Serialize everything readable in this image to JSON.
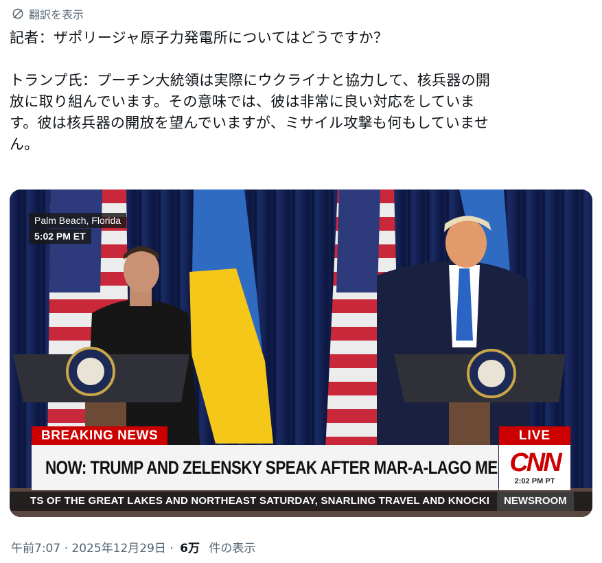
{
  "translate": {
    "label": "翻訳を表示",
    "icon": "translate-icon"
  },
  "tweet": {
    "line1": "記者：ザポリージャ原子力発電所についてはどうですか？",
    "line2": "トランプ氏：プーチン大統領は実際にウクライナと協力して、核兵器の開",
    "line3": "放に取り組んでいます。その意味では、彼は非常に良い対応をしていま",
    "line4": "す。彼は核兵器の開放を望んでいますが、ミサイル攻撃も何もしていませ",
    "line5": "ん。"
  },
  "video": {
    "location": "Palm Beach, Florida",
    "local_time": "5:02 PM ET",
    "breaking": "BREAKING NEWS",
    "live": "LIVE",
    "headline": "NOW: TRUMP AND ZELENSKY SPEAK AFTER MAR-A-LAGO MEETING",
    "network": "CNN",
    "network_time": "2:02 PM PT",
    "ticker": "TS OF THE GREAT LAKES AND NORTHEAST SATURDAY, SNARLING TRAVEL AND KNOCKI",
    "program": "NEWSROOM"
  },
  "meta": {
    "time": "午前7:07",
    "sep1": "·",
    "date": "2025年12月29日",
    "sep2": "·",
    "views": "6万",
    "views_label": "件の表示"
  },
  "colors": {
    "secondary_text": "#536471",
    "cnn_red": "#cc0000",
    "curtain": "#0e1a45"
  }
}
